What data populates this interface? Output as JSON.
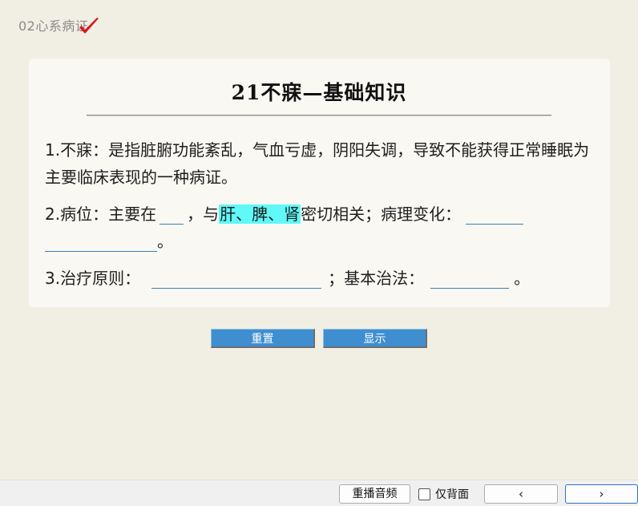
{
  "deck": {
    "title": "02心系病证"
  },
  "card": {
    "title": "21不寐—基础知识",
    "p1": {
      "num": "1.",
      "text": "不寐：是指脏腑功能紊乱，气血亏虚，阴阳失调，导致不能获得正常睡眠为主要临床表现的一种病证。"
    },
    "p2": {
      "num": "2.",
      "lead": "病位：主要在",
      "comma": "，与",
      "highlight": "肝、脾、肾",
      "mid": "密切相关；病理变化：",
      "end": "。"
    },
    "p3": {
      "num": "3.",
      "lead": "治疗原则：",
      "mid": "；基本治法：",
      "end": "。"
    }
  },
  "buttons": {
    "reset": "重置",
    "show": "显示"
  },
  "bottom": {
    "replay": "重播音频",
    "back_only": "仅背面",
    "back_only_checked": false,
    "prev": "‹",
    "next": "›"
  },
  "colors": {
    "background": "#f1efe4",
    "card": "#f9f8f3",
    "highlight": "#5ff9f7",
    "button": "#3f8fd0",
    "check": "#e0161d"
  }
}
